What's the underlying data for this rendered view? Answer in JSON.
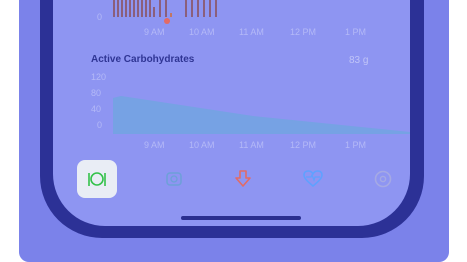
{
  "bolus_chart": {
    "y_label": "0",
    "x_ticks": [
      "9 AM",
      "10 AM",
      "11 AM",
      "12 PM",
      "1 PM"
    ]
  },
  "carbs": {
    "title": "Active Carbohydrates",
    "value": "83 g",
    "y_ticks": [
      "120",
      "80",
      "40",
      "0"
    ],
    "x_ticks": [
      "9 AM",
      "10 AM",
      "11 AM",
      "12 PM",
      "1 PM"
    ]
  },
  "tabs": [
    {
      "icon": "fork-knife-icon",
      "active": true
    },
    {
      "icon": "pump-icon",
      "active": false
    },
    {
      "icon": "bolus-arrow-icon",
      "active": false
    },
    {
      "icon": "heart-icon",
      "active": false
    },
    {
      "icon": "gear-icon",
      "active": false
    }
  ],
  "colors": {
    "accent_green": "#33c24a",
    "bolus_orange": "#e26b66",
    "heart_blue": "#5fa1ff",
    "chart_fill": "#6ea7df"
  }
}
